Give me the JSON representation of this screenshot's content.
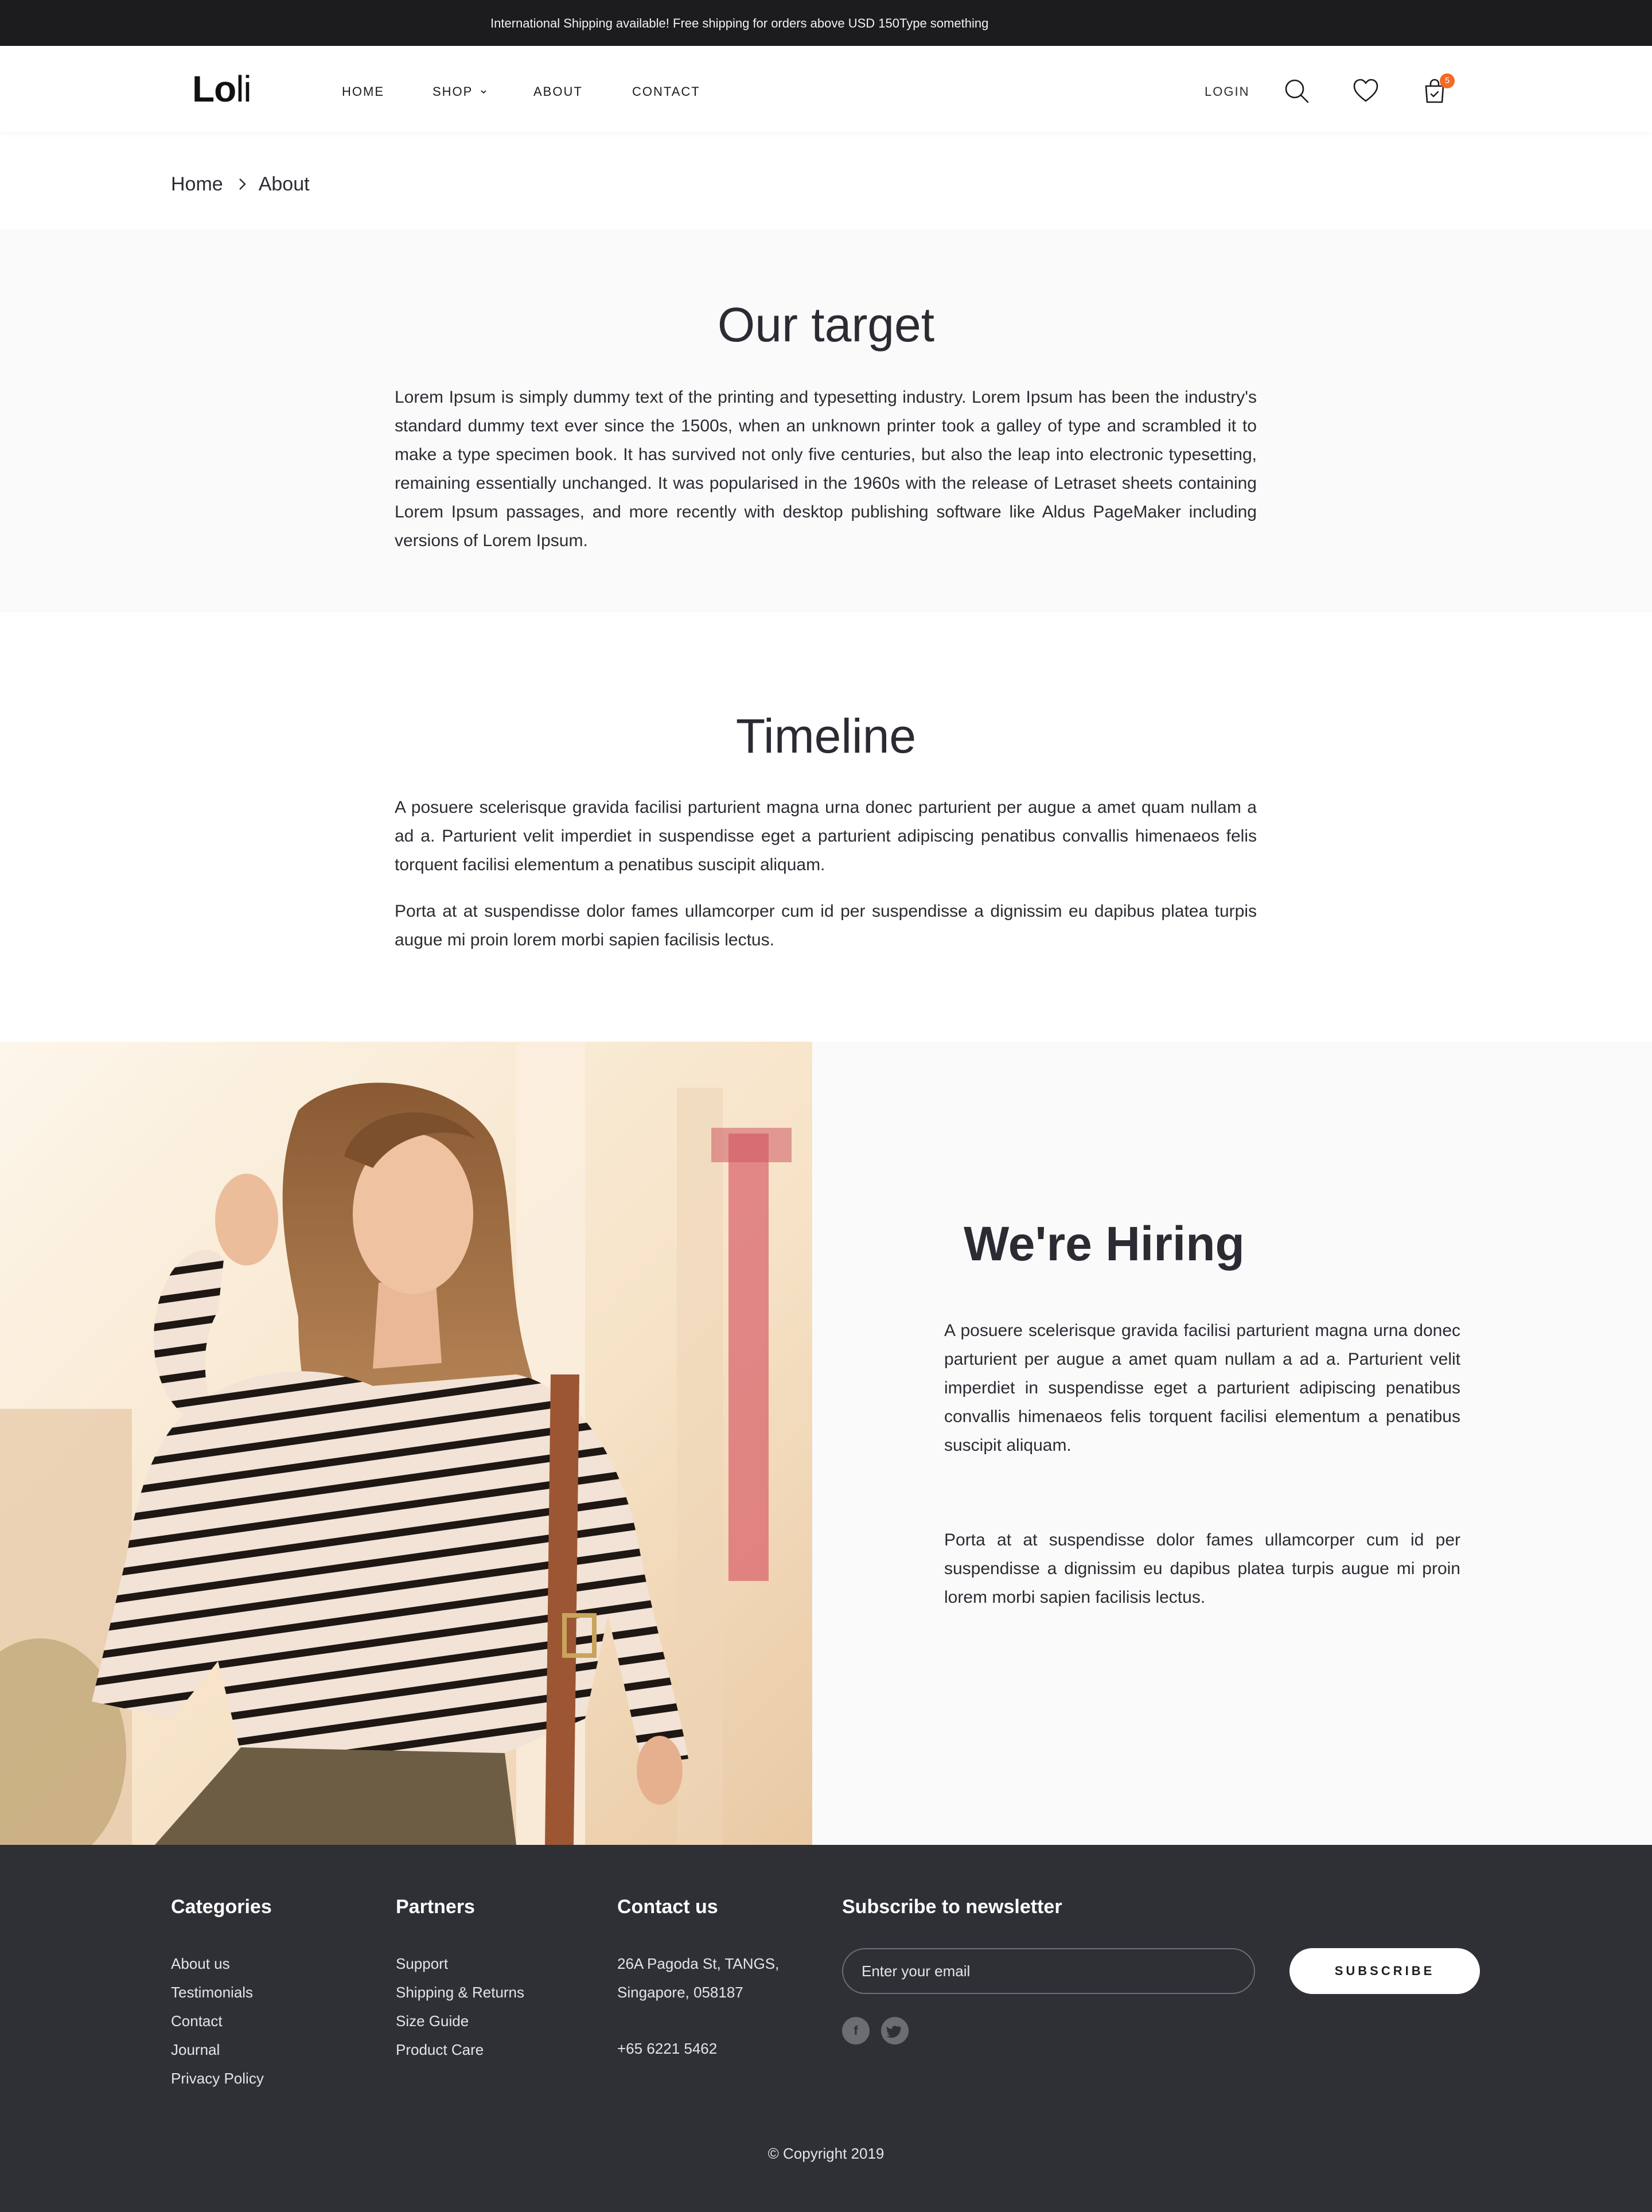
{
  "topbar": {
    "announcement": "International Shipping available! Free shipping for orders above USD 150Type something"
  },
  "header": {
    "logo_main": "Lo",
    "logo_tail": "li",
    "nav": {
      "home": "HOME",
      "shop": "SHOP",
      "about": "ABOUT",
      "contact": "CONTACT"
    },
    "login": "LOGIN",
    "cart_count": "5",
    "icons": [
      "search-icon",
      "heart-icon",
      "shopping-bag-icon",
      "chevron-down-icon"
    ],
    "accent_color": "#f26a25"
  },
  "breadcrumb": {
    "home": "Home",
    "current": "About"
  },
  "our_target": {
    "title": "Our target",
    "text": "Lorem Ipsum is simply dummy text of the printing and typesetting industry. Lorem Ipsum has been the industry's standard dummy text ever since the 1500s, when an unknown printer took a galley of type and scrambled it to make a type specimen book. It has survived not only five centuries, but also the leap into electronic typesetting, remaining essentially unchanged. It was popularised in the 1960s with the release of Letraset sheets containing Lorem Ipsum passages, and more recently with desktop publishing software like Aldus PageMaker including versions of Lorem Ipsum."
  },
  "timeline": {
    "title": "Timeline",
    "p1": "A posuere scelerisque gravida facilisi parturient magna urna donec parturient per augue a amet quam nullam a ad a. Parturient velit imperdiet in suspendisse eget a parturient adipiscing penatibus convallis himenaeos felis torquent facilisi elementum a penatibus suscipit aliquam.",
    "p2": "Porta at at suspendisse dolor fames ullamcorper cum id per suspendisse a dignissim eu dapibus platea turpis augue mi proin lorem morbi sapien facilisis lectus."
  },
  "hiring": {
    "title": "We're Hiring",
    "p1": "A posuere scelerisque gravida facilisi parturient magna urna donec parturient per augue a amet quam nullam a ad a. Parturient velit imperdiet in suspendisse eget a parturient adipiscing penatibus convallis himenaeos felis torquent facilisi elementum a penatibus suscipit aliquam.",
    "p2": "Porta at at suspendisse dolor fames ullamcorper cum id per suspendisse a dignissim eu dapibus platea turpis augue mi proin lorem morbi sapien facilisis lectus."
  },
  "footer": {
    "categories": {
      "title": "Categories",
      "items": [
        "About us",
        "Testimonials",
        "Contact",
        "Journal",
        "Privacy Policy"
      ]
    },
    "partners": {
      "title": "Partners",
      "items": [
        "Support",
        "Shipping & Returns",
        "Size Guide",
        "Product Care"
      ]
    },
    "contact": {
      "title": "Contact us",
      "address_line1": "26A Pagoda St, TANGS,",
      "address_line2": "Singapore, 058187",
      "phone": "+65 6221 5462"
    },
    "newsletter": {
      "title": "Subscribe to newsletter",
      "placeholder": "Enter your email",
      "button": "SUBSCRIBE",
      "social": [
        "facebook-icon",
        "twitter-icon"
      ]
    },
    "copyright": "© Copyright 2019"
  }
}
